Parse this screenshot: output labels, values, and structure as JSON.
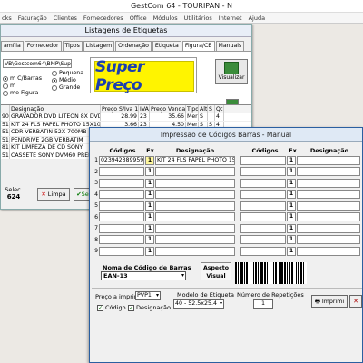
{
  "app": {
    "title": "GestCom 64 - TOURIPAN - N",
    "menu": [
      "cks",
      "Faturação",
      "Clientes",
      "Fornecedores",
      "Office",
      "Módulos",
      "Utilitários",
      "Internet",
      "Ajuda"
    ]
  },
  "listagens": {
    "title": "Listagens de Etiquetas",
    "tabs": [
      "amília",
      "Fornecedor",
      "Tipos",
      "Listagem",
      "Ordenação",
      "Etiqueta",
      "Figura/CB",
      "Manuais"
    ],
    "active_tab": "Figura/CB",
    "path": "VB\\Gestcom64\\BMP\\Super",
    "left_options": [
      "m C/Barras",
      "m",
      "me Figura"
    ],
    "size_options": [
      "Pequena",
      "Médio",
      "Grande"
    ],
    "size_selected": "Médio",
    "logo_text": "Super Preço",
    "visualizar_label": "Visualizar",
    "table": {
      "headers": [
        "",
        "Designação",
        "Preço S/Iva 1",
        "IVA",
        "Preço Venda 1",
        "Tipo",
        "Alt",
        "S",
        "Qt"
      ],
      "rows": [
        [
          "900",
          "GRAVADOR DVD LITEON 8X DVD-R+ /",
          "28.99",
          "23",
          "35.66",
          "Mer",
          "S",
          "",
          "4"
        ],
        [
          "516",
          "KIT 24 FLS PAPEL PHOTO 15X10",
          "3.66",
          "23",
          "4.50",
          "Mer",
          "S",
          "S",
          "4"
        ],
        [
          "515",
          "CDR VERBATIN 52X 700MB PK",
          "",
          "",
          "",
          "",
          "",
          "",
          ""
        ],
        [
          "516",
          "PENDRIVE 2GB VERBATIM",
          "",
          "",
          "",
          "",
          "",
          "",
          ""
        ],
        [
          "815",
          "KIT LIMPEZA DE CD SONY",
          "",
          "",
          "",
          "",
          "",
          "",
          ""
        ],
        [
          "515",
          "CASSETE SONY DVM60 PREMI",
          "",
          "",
          "",
          "",
          "",
          "",
          ""
        ],
        [
          "S13",
          "PACK 5 CASSETE SONY DV PRE",
          "",
          "",
          "",
          "",
          "",
          "",
          ""
        ],
        [
          "515",
          "KIT ACESSÓRIOS P/ PC MEMO",
          "",
          "",
          "",
          "",
          "",
          "",
          ""
        ]
      ]
    },
    "selec_label": "Selec.",
    "selec_count": "624",
    "limpa_label": "Limpa",
    "sel_label": "Se"
  },
  "impressao": {
    "title": "Impressão de Códigos Barras - Manual",
    "col_codigos": "Códigos",
    "col_ex": "Ex",
    "col_designacao": "Designação",
    "rows_left": [
      {
        "n": "1",
        "code": "0239423899592",
        "ex": "1",
        "des": "KIT 24 FLS PAPEL PHOTO 15"
      },
      {
        "n": "2",
        "code": "",
        "ex": "1",
        "des": ""
      },
      {
        "n": "3",
        "code": "",
        "ex": "1",
        "des": ""
      },
      {
        "n": "4",
        "code": "",
        "ex": "1",
        "des": ""
      },
      {
        "n": "5",
        "code": "",
        "ex": "1",
        "des": ""
      },
      {
        "n": "6",
        "code": "",
        "ex": "1",
        "des": ""
      },
      {
        "n": "7",
        "code": "",
        "ex": "1",
        "des": ""
      },
      {
        "n": "8",
        "code": "",
        "ex": "1",
        "des": ""
      },
      {
        "n": "9",
        "code": "",
        "ex": "1",
        "des": ""
      }
    ],
    "rows_right_ex": [
      "1",
      "1",
      "1",
      "1",
      "1",
      "1",
      "1",
      "1",
      "1"
    ],
    "nome_codigo_label": "Noma de Código de Barras",
    "nome_codigo_value": "EAN-13",
    "aspecto_label": "Aspecto Visual",
    "preco_label": "Preço a imprimir:",
    "preco_value": "PVP1",
    "modelo_label": "Modelo de Etiqueta",
    "modelo_value": "40 - 52.5x25.4",
    "repeticoes_label": "Número de Repetições",
    "repeticoes_value": "1",
    "codigo_label": "Código",
    "designacao_label": "Designação",
    "imprimir_label": "Imprimi"
  }
}
